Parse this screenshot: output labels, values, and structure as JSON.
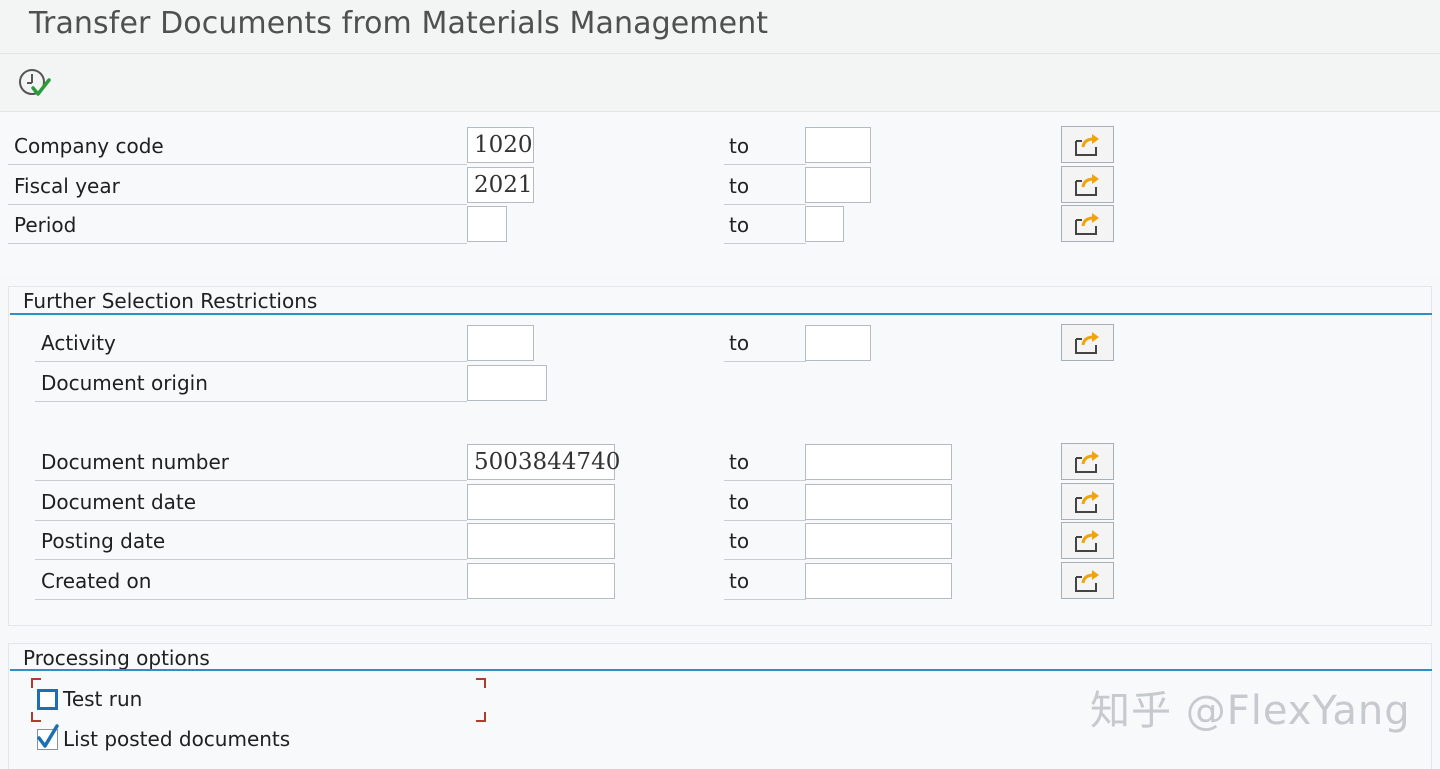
{
  "window": {
    "title": "Transfer Documents from Materials Management"
  },
  "toolbar": {
    "execute_icon": "execute-clock-check-icon"
  },
  "main_selection": {
    "to_label": "to",
    "rows": [
      {
        "label": "Company code",
        "from": "1020",
        "to": ""
      },
      {
        "label": "Fiscal year",
        "from": "2021",
        "to": ""
      },
      {
        "label": "Period",
        "from": "",
        "to": ""
      }
    ]
  },
  "further_restrictions": {
    "header": "Further Selection Restrictions",
    "activity": {
      "label": "Activity",
      "from": "",
      "to": ""
    },
    "document_origin": {
      "label": "Document origin",
      "value": ""
    },
    "document_number": {
      "label": "Document number",
      "from": "5003844740",
      "to": ""
    },
    "document_date": {
      "label": "Document date",
      "from": "",
      "to": ""
    },
    "posting_date": {
      "label": "Posting date",
      "from": "",
      "to": ""
    },
    "created_on": {
      "label": "Created on",
      "from": "",
      "to": ""
    }
  },
  "processing_options": {
    "header": "Processing options",
    "test_run": {
      "label": "Test run",
      "checked": false
    },
    "list_posted": {
      "label": "List posted documents",
      "checked": true
    }
  },
  "watermark": "知乎 @FlexYang",
  "colors": {
    "accent_line": "#2f8fc8",
    "arrow_orange": "#f0a30a",
    "check_blue": "#1a6fb5"
  }
}
